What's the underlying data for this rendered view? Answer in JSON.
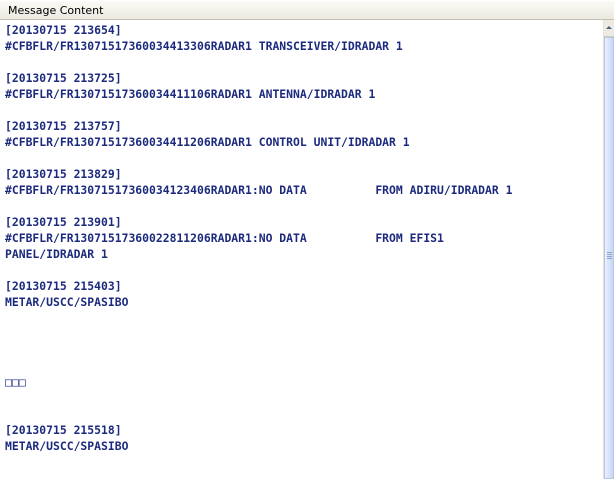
{
  "header": {
    "column_title": "Message Content"
  },
  "messages": [
    "[20130715 213654]",
    "#CFBFLR/FR13071517360034413306RADAR1 TRANSCEIVER/IDRADAR 1",
    "[20130715 213725]",
    "#CFBFLR/FR13071517360034411106RADAR1 ANTENNA/IDRADAR 1",
    "[20130715 213757]",
    "#CFBFLR/FR13071517360034411206RADAR1 CONTROL UNIT/IDRADAR 1",
    "[20130715 213829]",
    "#CFBFLR/FR13071517360034123406RADAR1:NO DATA          FROM ADIRU/IDRADAR 1",
    "[20130715 213901]",
    "#CFBFLR/FR13071517360022811206RADAR1:NO DATA          FROM EFIS1",
    "PANEL/IDRADAR 1",
    "[20130715 215403]",
    "METAR/USCC/SPASIBO",
    "□□□",
    "[20130715 215518]",
    "METAR/USCC/SPASIBO"
  ]
}
